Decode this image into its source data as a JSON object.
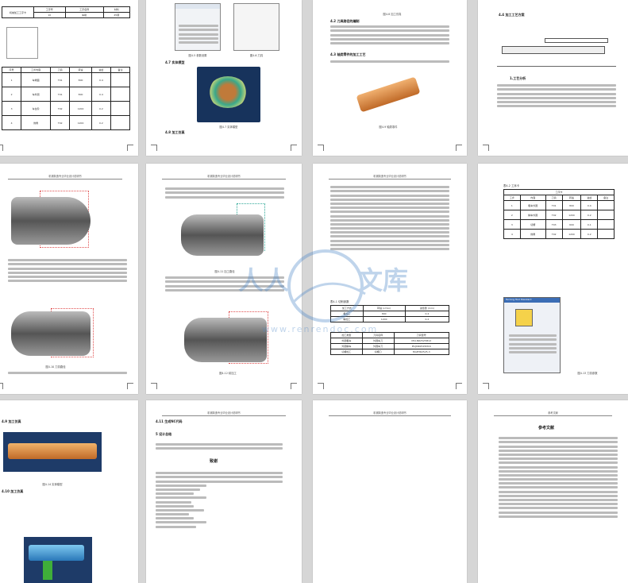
{
  "pages": [
    {
      "id": "p1",
      "num": "",
      "header": "",
      "title": "机械加工工序卡",
      "table_rows": [
        [
          "工序号",
          "工序名称",
          "材料"
        ],
        [
          "10",
          "车削",
          "45钢"
        ],
        [
          "",
          "",
          "工步1",
          "工步2",
          "工步3",
          "工步4"
        ]
      ],
      "steps": [
        "车端面",
        "车外圆",
        "车台阶",
        "倒角"
      ]
    },
    {
      "id": "p2",
      "num": "·11·",
      "header": "",
      "fig1": "图4-5 参数设置",
      "fig2": "图4-6 刀具",
      "sec": "4.7 实体模型",
      "fig3": "图4-7 实体模型",
      "sec2": "4.8 加工仿真"
    },
    {
      "id": "p3",
      "num": "·13·",
      "header": "",
      "fig1": "图4-8 加工仿真",
      "sec": "4.2 刀具路径的编制",
      "heading": "4.3 轴类零件的加工工艺",
      "fig2": "图4-9 轴类零件"
    },
    {
      "id": "p4",
      "num": "·15·",
      "header": "",
      "sec": "4.4 加工工艺方案",
      "heading": "1.工艺分析"
    },
    {
      "id": "p5",
      "num": "·17·",
      "header": "机械制造专业毕业设计说明书",
      "fig": "图4-10 刀具路径"
    },
    {
      "id": "p6",
      "num": "·18·",
      "header": "机械制造专业毕业设计说明书",
      "fig1": "图4-11 加工路径",
      "fig2": "图4-12 精加工"
    },
    {
      "id": "p7",
      "num": "·19·",
      "header": "机械制造专业毕业设计说明书",
      "table_title": "表4-1 切削参数",
      "t1": [
        [
          "加工方式",
          "转速 (r/min)",
          "进给量 (mm)"
        ],
        [
          "粗加工",
          "800",
          "0.4"
        ],
        [
          "精加工",
          "1200",
          "0.2"
        ]
      ],
      "t2": [
        [
          "加工类型",
          "刀具名称",
          "刀具型号"
        ],
        [
          "外圆粗车",
          "外圆车刀",
          "MCLNR2525M12"
        ],
        [
          "外圆精车",
          "外圆车刀",
          "MVJNR2525M16"
        ],
        [
          "切槽加工",
          "切槽刀",
          "MGEHR2525-3"
        ]
      ]
    },
    {
      "id": "p8",
      "num": "·20·",
      "header": "",
      "table_title": "表4-2 工序卡",
      "fig": "图4-13 刀具参数",
      "dialog_title": "Turning Tool Standard"
    },
    {
      "id": "p9",
      "num": "",
      "header": "",
      "sec": "4.9 加工仿真",
      "fig": "图4-14 实体模型",
      "sec2": "4.10 加工仿真"
    },
    {
      "id": "p10",
      "num": "",
      "header": "机械制造专业毕业设计说明书",
      "sec": "4.11 生成NC代码",
      "sec2": "5 设计总结",
      "heading": "致谢"
    },
    {
      "id": "p11",
      "num": "",
      "header": "机械制造专业毕业设计说明书"
    },
    {
      "id": "p12",
      "num": "",
      "header": "参考文献",
      "heading": "参考文献"
    }
  ],
  "watermark": {
    "brand": "人人",
    "brand2": "文库",
    "url": "www.renrendoc.com",
    "color": "#4a86c8"
  }
}
